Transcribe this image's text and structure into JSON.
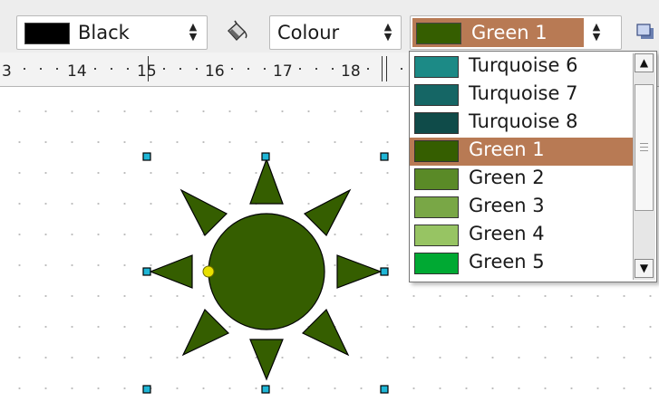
{
  "toolbar": {
    "line_color": {
      "label": "Black",
      "swatch": "#000000"
    },
    "fill_style": {
      "label": "Colour"
    },
    "fill_color": {
      "label": "Green 1",
      "swatch": "#355E00",
      "highlight": "#B87A54"
    },
    "icons": {
      "line_arrows": "spin-arrows-icon",
      "fill": "paint-bucket-icon",
      "shadow": "shadow-icon"
    }
  },
  "ruler": {
    "labels": [
      "3",
      "14",
      "15",
      "16",
      "17",
      "18"
    ]
  },
  "dropdown": {
    "items": [
      {
        "label": "Turquoise 6",
        "color": "#1C8A86"
      },
      {
        "label": "Turquoise 7",
        "color": "#156665"
      },
      {
        "label": "Turquoise 8",
        "color": "#0F4B49"
      },
      {
        "label": "Green 1",
        "color": "#355E00",
        "selected": true
      },
      {
        "label": "Green 2",
        "color": "#5A8A27"
      },
      {
        "label": "Green 3",
        "color": "#79A746"
      },
      {
        "label": "Green 4",
        "color": "#97C463"
      },
      {
        "label": "Green 5",
        "color": "#00A933"
      }
    ],
    "scroll": {
      "up": "scroll-up-arrow-icon",
      "down": "scroll-down-arrow-icon"
    }
  },
  "shape": {
    "type": "sun",
    "fill": "#355E00",
    "handle_color": "#1FB6D6",
    "adjust_handle_color": "#E8E000"
  }
}
